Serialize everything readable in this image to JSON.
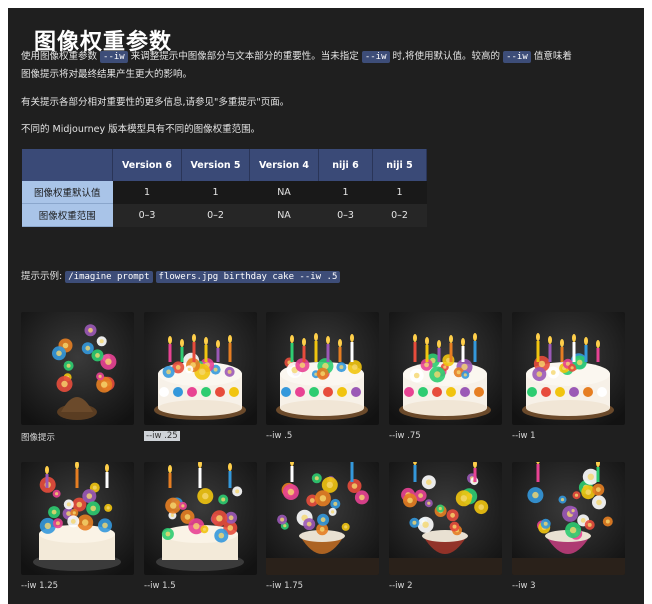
{
  "doc": {
    "title": "图像权重参数",
    "intro": {
      "p1_a": "使用图像权重参数",
      "p1_code1": "--iw",
      "p1_b": "来调整提示中图像部分与文本部分的重要性。当未指定",
      "p1_code2": "--iw",
      "p1_c": "时,将使用默认值。较高的",
      "p1_code3": "--iw",
      "p1_d": "值意味着",
      "p1_e": "图像提示将对最终结果产生更大的影响。"
    },
    "para2": "有关提示各部分相对重要性的更多信息,请参见\"多重提示\"页面。",
    "para3": "不同的 Midjourney 版本模型具有不同的图像权重范围。",
    "table": {
      "headers": [
        "Version 6",
        "Version 5",
        "Version 4",
        "niji 6",
        "niji 5"
      ],
      "rows": [
        {
          "label": "图像权重默认值",
          "cells": [
            "1",
            "1",
            "NA",
            "1",
            "1"
          ]
        },
        {
          "label": "图像权重范围",
          "cells": [
            "0–3",
            "0–2",
            "NA",
            "0–3",
            "0–2"
          ]
        }
      ]
    },
    "example": {
      "label": "提示示例:",
      "code1": "/imagine prompt",
      "code2": "flowers.jpg birthday cake --iw .5"
    },
    "gallery": [
      {
        "caption": "图像提示",
        "kind": "flowers",
        "highlight": false,
        "accent": "#c0392b"
      },
      {
        "caption": "--iw .25",
        "kind": "cake",
        "highlight": true,
        "accent": "#8e44ad"
      },
      {
        "caption": "--iw .5",
        "kind": "cake",
        "highlight": false,
        "accent": "#e67e22"
      },
      {
        "caption": "--iw .75",
        "kind": "cake",
        "highlight": false,
        "accent": "#d35400"
      },
      {
        "caption": "--iw 1",
        "kind": "cake",
        "highlight": false,
        "accent": "#c0392b"
      },
      {
        "caption": "--iw 1.25",
        "kind": "bouquetcake",
        "highlight": false,
        "accent": "#e74c3c"
      },
      {
        "caption": "--iw 1.5",
        "kind": "bouquetcake",
        "highlight": false,
        "accent": "#e84393"
      },
      {
        "caption": "--iw 1.75",
        "kind": "vase",
        "highlight": false,
        "accent": "#e67e22"
      },
      {
        "caption": "--iw 2",
        "kind": "vase",
        "highlight": false,
        "accent": "#c0392b"
      },
      {
        "caption": "--iw 3",
        "kind": "vase",
        "highlight": false,
        "accent": "#e84393"
      }
    ]
  }
}
